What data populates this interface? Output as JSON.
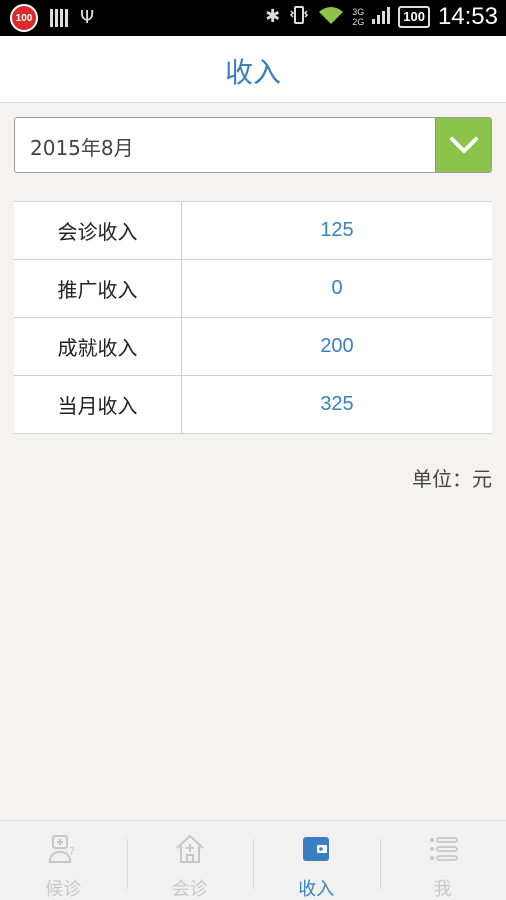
{
  "status_bar": {
    "badge": "100",
    "battery": "100",
    "network_top": "3G",
    "network_bottom": "2G",
    "time": "14:53"
  },
  "header": {
    "title": "收入"
  },
  "month_selector": {
    "value": "2015年8月",
    "icon": "chevron-down-icon"
  },
  "income_table": {
    "rows": [
      {
        "label": "会诊收入",
        "value": "125"
      },
      {
        "label": "推广收入",
        "value": "0"
      },
      {
        "label": "成就收入",
        "value": "200"
      },
      {
        "label": "当月收入",
        "value": "325"
      }
    ]
  },
  "unit_note": "单位：元",
  "tabbar": {
    "tabs": [
      {
        "label": "候诊",
        "icon": "doctor-icon",
        "active": false
      },
      {
        "label": "会诊",
        "icon": "clinic-house-icon",
        "active": false
      },
      {
        "label": "收入",
        "icon": "wallet-icon",
        "active": true
      },
      {
        "label": "我",
        "icon": "list-menu-icon",
        "active": false
      }
    ]
  },
  "colors": {
    "accent": "#3a7fc0",
    "dropdown_button": "#8cc34a",
    "inactive_tab": "#c7c7c7"
  }
}
